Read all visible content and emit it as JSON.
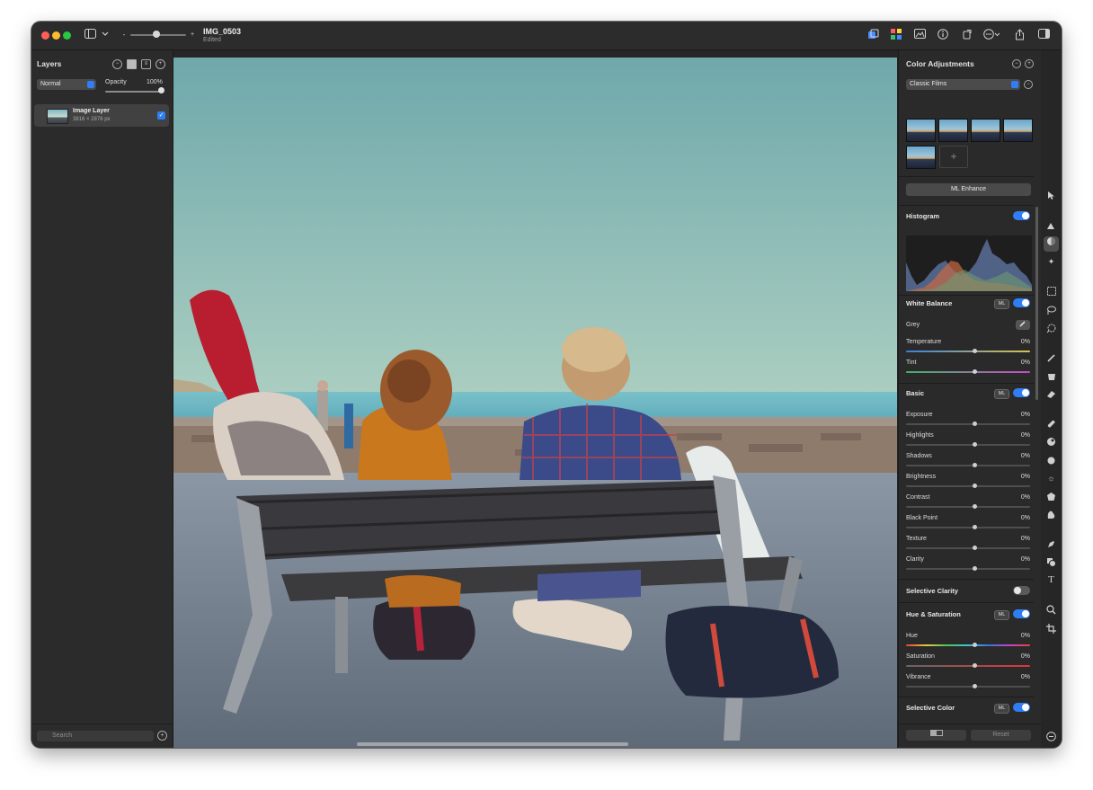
{
  "window": {
    "doc_title": "IMG_0503",
    "doc_status": "Edited"
  },
  "layers_panel": {
    "title": "Layers",
    "blend_mode": "Normal",
    "opacity_label": "Opacity",
    "opacity_value": "100%",
    "opacity_fraction": 1.0,
    "layers": [
      {
        "name": "Image Layer",
        "size": "3816 × 2876 px",
        "visible": true
      }
    ],
    "search_placeholder": "Search"
  },
  "adjustments_panel": {
    "title": "Color Adjustments",
    "preset": "Classic Films",
    "ml_enhance_label": "ML Enhance",
    "ml_badge": "ML",
    "histogram": {
      "title": "Histogram",
      "enabled": true
    },
    "white_balance": {
      "title": "White Balance",
      "enabled": true,
      "grey_label": "Grey",
      "items": [
        {
          "label": "Temperature",
          "value": "0%"
        },
        {
          "label": "Tint",
          "value": "0%"
        }
      ]
    },
    "basic": {
      "title": "Basic",
      "enabled": true,
      "items": [
        {
          "label": "Exposure",
          "value": "0%"
        },
        {
          "label": "Highlights",
          "value": "0%"
        },
        {
          "label": "Shadows",
          "value": "0%"
        },
        {
          "label": "Brightness",
          "value": "0%"
        },
        {
          "label": "Contrast",
          "value": "0%"
        },
        {
          "label": "Black Point",
          "value": "0%"
        },
        {
          "label": "Texture",
          "value": "0%"
        },
        {
          "label": "Clarity",
          "value": "0%"
        }
      ]
    },
    "selective_clarity": {
      "title": "Selective Clarity",
      "enabled": false
    },
    "hue_saturation": {
      "title": "Hue & Saturation",
      "enabled": true,
      "items": [
        {
          "label": "Hue",
          "value": "0%"
        },
        {
          "label": "Saturation",
          "value": "0%"
        },
        {
          "label": "Vibrance",
          "value": "0%"
        }
      ]
    },
    "selective_color": {
      "title": "Selective Color",
      "enabled": true
    },
    "reset_label": "Reset"
  },
  "colors": {
    "accent": "#2f7ef5",
    "panel_bg": "#2a2a2a",
    "window_bg": "#262626"
  },
  "icons": {
    "titlebar_left": [
      "sidebar-icon",
      "chevron-down-icon",
      "zoom-slider"
    ],
    "titlebar_right": [
      "layers-stack-icon",
      "color-adjust-icon",
      "image-icon",
      "info-icon",
      "rotate-icon",
      "more-icon",
      "share-icon",
      "right-sidebar-icon"
    ],
    "tools": [
      "arrow-icon",
      "retouch-icon",
      "color-adjust-icon",
      "magic-icon",
      "rect-select-icon",
      "lasso-icon",
      "quick-select-icon",
      "brush-icon",
      "bucket-icon",
      "eraser-icon",
      "repair-icon",
      "clone-icon",
      "blur-icon",
      "light-icon",
      "sharpen-icon",
      "smudge-icon",
      "pen-icon",
      "shapes-icon",
      "text-icon",
      "zoom-icon",
      "crop-icon"
    ]
  }
}
